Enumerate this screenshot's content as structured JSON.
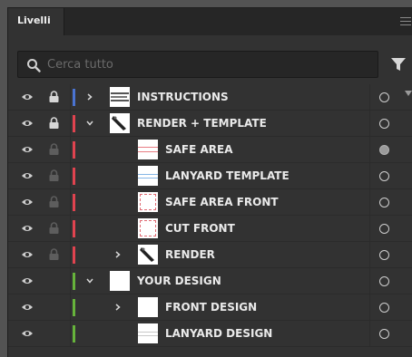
{
  "panel": {
    "tab_label": "Livelli",
    "menu_icon": "hamburger-icon"
  },
  "search": {
    "placeholder": "Cerca tutto",
    "value": "",
    "icon": "search-icon",
    "filter_icon": "filter-icon"
  },
  "colors": {
    "blue": "#4a73d1",
    "red": "#e0434f",
    "green": "#66b33b"
  },
  "layers": [
    {
      "name": "INSTRUCTIONS",
      "visible": true,
      "locked": true,
      "lock_style": "bright",
      "color": "blue",
      "expand": "collapsed",
      "indent": 0,
      "thumb": "text-thumb",
      "target": "empty"
    },
    {
      "name": "RENDER + TEMPLATE",
      "visible": true,
      "locked": true,
      "lock_style": "bright",
      "color": "red",
      "expand": "expanded",
      "indent": 0,
      "thumb": "render-thumb",
      "target": "empty"
    },
    {
      "name": "SAFE AREA",
      "visible": true,
      "locked": true,
      "lock_style": "dim",
      "color": "red",
      "expand": "none",
      "indent": 1,
      "thumb": "red-lines-thumb",
      "target": "filled"
    },
    {
      "name": "LANYARD TEMPLATE",
      "visible": true,
      "locked": true,
      "lock_style": "dim",
      "color": "red",
      "expand": "none",
      "indent": 1,
      "thumb": "blue-lines-thumb",
      "target": "empty"
    },
    {
      "name": "SAFE AREA FRONT",
      "visible": true,
      "locked": true,
      "lock_style": "dim",
      "color": "red",
      "expand": "none",
      "indent": 1,
      "thumb": "red-dashed-thumb",
      "target": "empty"
    },
    {
      "name": "CUT FRONT",
      "visible": true,
      "locked": true,
      "lock_style": "dim",
      "color": "red",
      "expand": "none",
      "indent": 1,
      "thumb": "red-dashed-thumb",
      "target": "empty"
    },
    {
      "name": "RENDER",
      "visible": true,
      "locked": true,
      "lock_style": "dim",
      "color": "red",
      "expand": "collapsed",
      "indent": 1,
      "thumb": "render-thumb",
      "target": "empty"
    },
    {
      "name": "YOUR DESIGN",
      "visible": true,
      "locked": false,
      "lock_style": "none",
      "color": "green",
      "expand": "expanded",
      "indent": 0,
      "thumb": "blank-thumb",
      "target": "empty"
    },
    {
      "name": "FRONT DESIGN",
      "visible": true,
      "locked": false,
      "lock_style": "none",
      "color": "green",
      "expand": "collapsed",
      "indent": 1,
      "thumb": "blank-thumb",
      "target": "empty"
    },
    {
      "name": "LANYARD DESIGN",
      "visible": true,
      "locked": false,
      "lock_style": "none",
      "color": "green",
      "expand": "none",
      "indent": 1,
      "thumb": "grey-lines-thumb",
      "target": "empty"
    }
  ]
}
